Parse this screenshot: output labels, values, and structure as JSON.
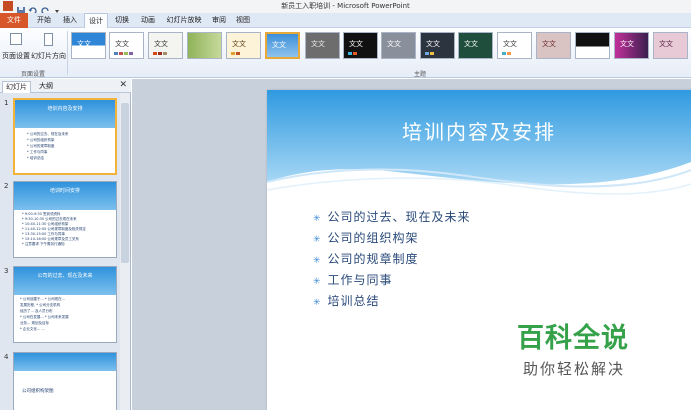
{
  "window": {
    "title": "新员工入职培训 - Microsoft PowerPoint"
  },
  "ribbon": {
    "tabs": [
      {
        "label": "文件",
        "state": "file"
      },
      {
        "label": "开始",
        "state": "normal"
      },
      {
        "label": "插入",
        "state": "normal"
      },
      {
        "label": "设计",
        "state": "active"
      },
      {
        "label": "切换",
        "state": "normal"
      },
      {
        "label": "动画",
        "state": "normal"
      },
      {
        "label": "幻灯片放映",
        "state": "normal"
      },
      {
        "label": "审阅",
        "state": "normal"
      },
      {
        "label": "视图",
        "state": "normal"
      }
    ],
    "page_setup": {
      "page_setup_label": "页面设置",
      "orientation_label": "幻灯片方向",
      "group_label": "页面设置"
    },
    "themes_group_label": "主题",
    "theme_sample_text": "文文"
  },
  "panel": {
    "tabs": {
      "slides": "幻灯片",
      "outline": "大纲"
    },
    "close_glyph": "✕",
    "thumbnails": [
      {
        "number": "1",
        "title": "培训内容及安排",
        "lines": [
          "* 公司的过去、现在及未来",
          "* 公司的组织构架",
          "* 公司的规章制度",
          "* 工作与同事",
          "* 培训总结"
        ]
      },
      {
        "number": "2",
        "title": "培训时间安排",
        "lines": [
          "* 9:00-9:30   签到领资料",
          "* 9:30-10:30  公司的过去现在未来",
          "* 10:40-11:30 公司组织构架",
          "* 11:40-12:00 公司规章制度及相关规定",
          "* 13:30-15:00 工作与同事",
          "* 15:10-16:00 公司规章及员工关系",
          "* 注意要求 下午需另行通知"
        ]
      },
      {
        "number": "3",
        "title": "公司的过去、现在及未来",
        "lines": [
          "* 公司创建于...    * 公司现在...",
          "  发展历程,      * 公司分支机构",
          "  经历了...        及人员分布",
          "* 公司在发展...   * 公司未来发展",
          "  业务...          规划及目标",
          "* 企业文化...     ..."
        ]
      },
      {
        "number": "4",
        "title": "",
        "lines": [
          "",
          "公司组织构架图"
        ]
      }
    ]
  },
  "slide": {
    "title": "培训内容及安排",
    "bullets": [
      "公司的过去、现在及未来",
      "公司的组织构架",
      "公司的规章制度",
      "工作与同事",
      "培训总结"
    ],
    "bullet_glyph": "✳"
  },
  "watermark": {
    "main": "百科全说",
    "sub": "助你轻松解决"
  },
  "colors": {
    "file_tab": "#d7572b",
    "selection": "#f2b33a",
    "slide_band": "#2f9ae0",
    "watermark_green": "#35a24a"
  }
}
